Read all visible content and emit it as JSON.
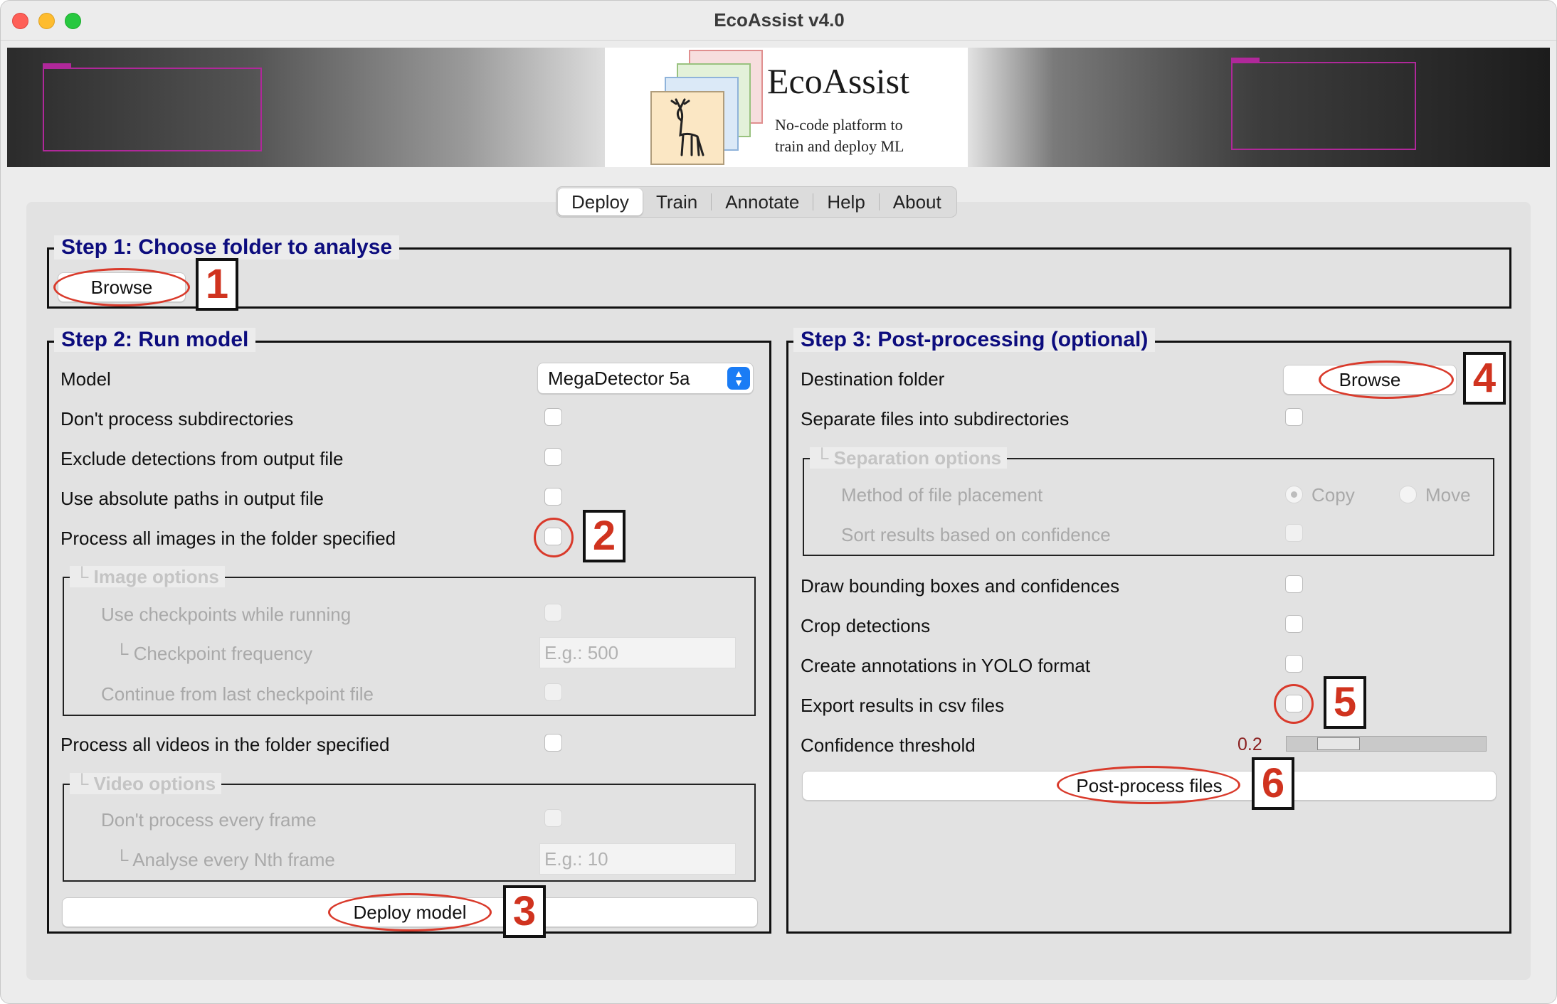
{
  "window": {
    "title": "EcoAssist v4.0"
  },
  "banner": {
    "logo_title": "EcoAssist",
    "logo_subtitle_line1": "No-code platform to",
    "logo_subtitle_line2": "train and deploy ML"
  },
  "tabs": [
    {
      "label": "Deploy",
      "active": true
    },
    {
      "label": "Train"
    },
    {
      "label": "Annotate"
    },
    {
      "label": "Help"
    },
    {
      "label": "About"
    }
  ],
  "step1": {
    "title": "Step 1: Choose folder to analyse",
    "browse_label": "Browse"
  },
  "step2": {
    "title": "Step 2: Run model",
    "model_label": "Model",
    "model_value": "MegaDetector 5a",
    "no_subdirs_label": "Don't process subdirectories",
    "exclude_detections_label": "Exclude detections from output file",
    "absolute_paths_label": "Use absolute paths in output file",
    "process_images_label": "Process all images in the folder specified",
    "image_options": {
      "title": "└ Image options",
      "checkpoints_label": "Use checkpoints while running",
      "checkpoint_freq_label": "└ Checkpoint frequency",
      "checkpoint_freq_placeholder": "E.g.: 500",
      "continue_checkpoint_label": "Continue from last checkpoint file"
    },
    "process_videos_label": "Process all videos in the folder specified",
    "video_options": {
      "title": "└ Video options",
      "every_frame_label": "Don't process every frame",
      "nth_frame_label": "└ Analyse every Nth frame",
      "nth_frame_placeholder": "E.g.: 10"
    },
    "deploy_label": "Deploy model"
  },
  "step3": {
    "title": "Step 3: Post-processing (optional)",
    "destination_label": "Destination folder",
    "browse_label": "Browse",
    "separate_label": "Separate files into subdirectories",
    "separation_options": {
      "title": "└ Separation options",
      "method_label": "Method of file placement",
      "copy_label": "Copy",
      "move_label": "Move",
      "sort_label": "Sort results based on confidence"
    },
    "draw_boxes_label": "Draw bounding boxes and confidences",
    "crop_label": "Crop detections",
    "yolo_label": "Create annotations in YOLO format",
    "csv_label": "Export results in csv files",
    "threshold_label": "Confidence threshold",
    "threshold_value": "0.2",
    "postprocess_label": "Post-process files"
  },
  "callouts": [
    "1",
    "2",
    "3",
    "4",
    "5",
    "6"
  ],
  "colors": {
    "step_title": "#0d0d7e",
    "callout_red": "#d0331f",
    "accent_blue": "#1a7cf5"
  }
}
